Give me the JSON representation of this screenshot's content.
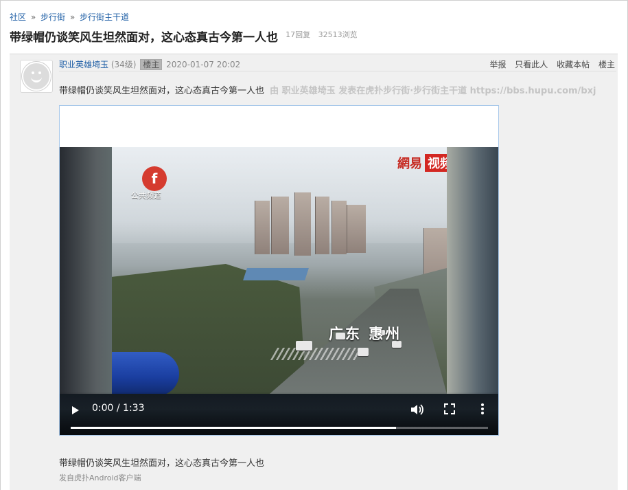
{
  "breadcrumb": {
    "items": [
      "社区",
      "步行街",
      "步行街主干道"
    ],
    "separator": "»"
  },
  "thread": {
    "title": "带绿帽仍谈笑风生坦然面对，这心态真古今第一人也",
    "replies": "17回复",
    "views": "32513浏览"
  },
  "post": {
    "author": "职业英雄埼玉",
    "level": "(34级)",
    "badge": "楼主",
    "timestamp": "2020-01-07 20:02",
    "actions": [
      "举报",
      "只看此人",
      "收藏本帖",
      "楼主"
    ],
    "intro_text": "带绿帽仍谈笑风生坦然面对，这心态真古今第一人也",
    "source_text": "由 职业英雄埼玉 发表在虎扑步行街·步行街主干道 https://bbs.hupu.com/bxj",
    "body_text": "带绿帽仍谈笑风生坦然面对，这心态真古今第一人也",
    "client_text": "发自虎扑Android客户端"
  },
  "video": {
    "time": "0:00 / 1:33",
    "progress_fraction": 0.78,
    "overlay": {
      "channel_logo_glyph": "f",
      "channel_logo_text": "公共频道",
      "watermark_brand": "網易",
      "watermark_label": "视频",
      "location": "广东 惠州"
    },
    "icons": [
      "play-icon",
      "volume-icon",
      "fullscreen-icon",
      "more-vertical-icon"
    ]
  },
  "colors": {
    "link": "#1f5fa6",
    "post_background": "#f0f0f0",
    "video_border": "#a8c8ea",
    "watermark_red": "#d32722"
  }
}
